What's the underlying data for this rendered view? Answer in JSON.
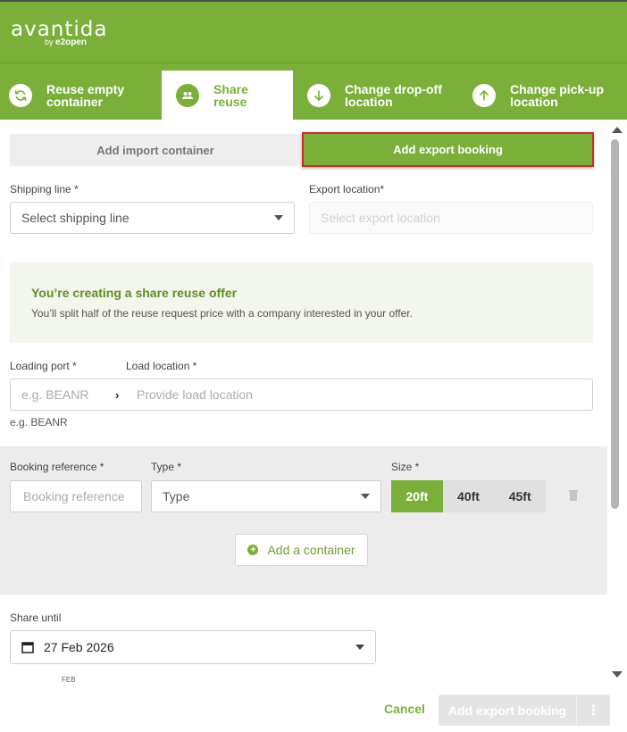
{
  "app": {
    "logo": "avantida",
    "logo_by": "by",
    "logo_brand": "e2open"
  },
  "tabs": [
    {
      "label": "Reuse empty container",
      "icon": "refresh-icon",
      "active": false
    },
    {
      "label": "Share reuse",
      "icon": "users-icon",
      "active": true
    },
    {
      "label": "Change drop-off location",
      "icon": "arrow-down-icon",
      "active": false
    },
    {
      "label": "Change pick-up location",
      "icon": "arrow-up-icon",
      "active": false
    }
  ],
  "mode_toggle": {
    "import_label": "Add import container",
    "export_label": "Add export booking",
    "selected": "export"
  },
  "shipping_line": {
    "label": "Shipping line *",
    "placeholder": "Select shipping line"
  },
  "export_location": {
    "label": "Export location*",
    "placeholder": "Select export location"
  },
  "info": {
    "title": "You’re creating a share reuse offer",
    "text": "You’ll split half of the reuse request price with a company interested in your offer."
  },
  "loading": {
    "port_label": "Loading port *",
    "location_label": "Load location *",
    "port_placeholder": "e.g. BEANR",
    "location_placeholder": "Provide load location",
    "hint": "e.g. BEANR"
  },
  "container": {
    "booking_label": "Booking reference *",
    "booking_placeholder": "Booking reference",
    "type_label": "Type *",
    "type_placeholder": "Type",
    "size_label": "Size *",
    "sizes": [
      "20ft",
      "40ft",
      "45ft"
    ],
    "selected_size": "20ft",
    "add_label": "Add a container"
  },
  "share_until": {
    "label": "Share until",
    "value": "27 Feb 2026",
    "month_hint": "FEB"
  },
  "footer": {
    "cancel_label": "Cancel",
    "submit_label": "Add export booking",
    "more_label": "⋮"
  },
  "colors": {
    "brand_green": "#7aaf3a",
    "highlight_red": "#d12a2a"
  }
}
